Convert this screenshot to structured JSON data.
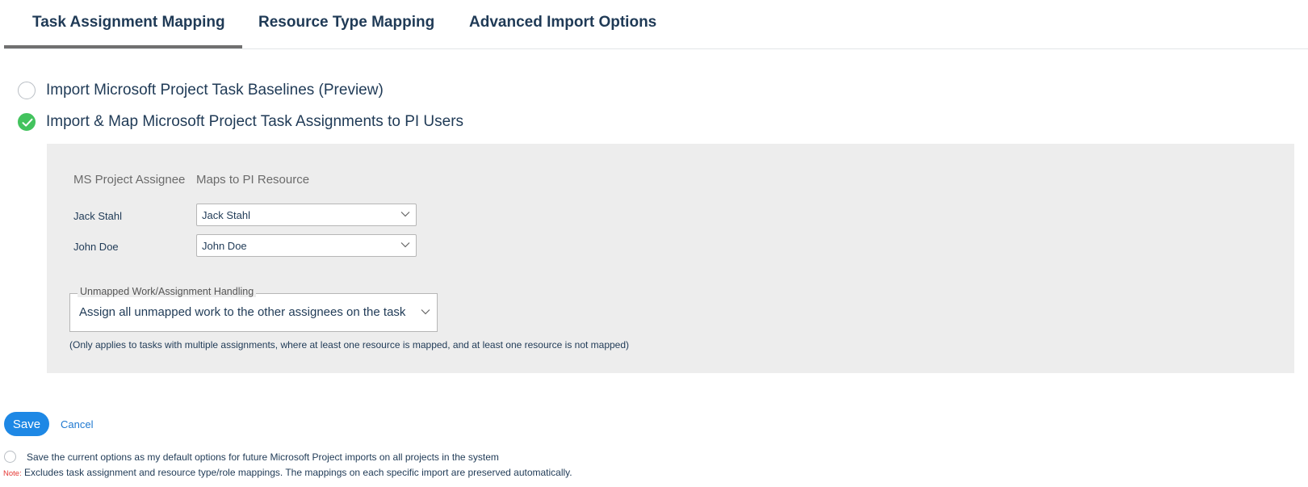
{
  "tabs": {
    "items": [
      {
        "label": "Task Assignment Mapping",
        "active": true
      },
      {
        "label": "Resource Type Mapping",
        "active": false
      },
      {
        "label": "Advanced Import Options",
        "active": false
      }
    ]
  },
  "options": {
    "baselines_label": "Import Microsoft Project Task Baselines (Preview)",
    "baselines_checked": false,
    "assignments_label": "Import & Map Microsoft Project Task Assignments to PI Users",
    "assignments_checked": true
  },
  "mapping": {
    "header_assignee": "MS Project Assignee",
    "header_resource": "Maps to PI Resource",
    "rows": [
      {
        "assignee": "Jack Stahl",
        "resource": "Jack Stahl"
      },
      {
        "assignee": "John Doe",
        "resource": "John Doe"
      }
    ]
  },
  "unmapped": {
    "legend": "Unmapped Work/Assignment Handling",
    "value": "Assign all unmapped work to the other assignees on the task",
    "hint": "(Only applies to tasks with multiple assignments, where at least one resource is mapped, and at least one resource is not mapped)"
  },
  "actions": {
    "save_label": "Save",
    "cancel_label": "Cancel"
  },
  "default_option": {
    "label": "Save the current options as my default options for future Microsoft Project imports on all projects in the system",
    "checked": false
  },
  "note": {
    "prefix": "Note:",
    "text": " Excludes task assignment and resource type/role mappings. The mappings on each specific import are preserved automatically."
  },
  "colors": {
    "accent": "#1e88e5",
    "check_green": "#43c35e",
    "panel_bg": "#ededed",
    "text": "#1f3a56",
    "note_red": "#e53935"
  },
  "icons": {
    "check": "check-icon",
    "dropdown": "chevron-down-icon"
  }
}
